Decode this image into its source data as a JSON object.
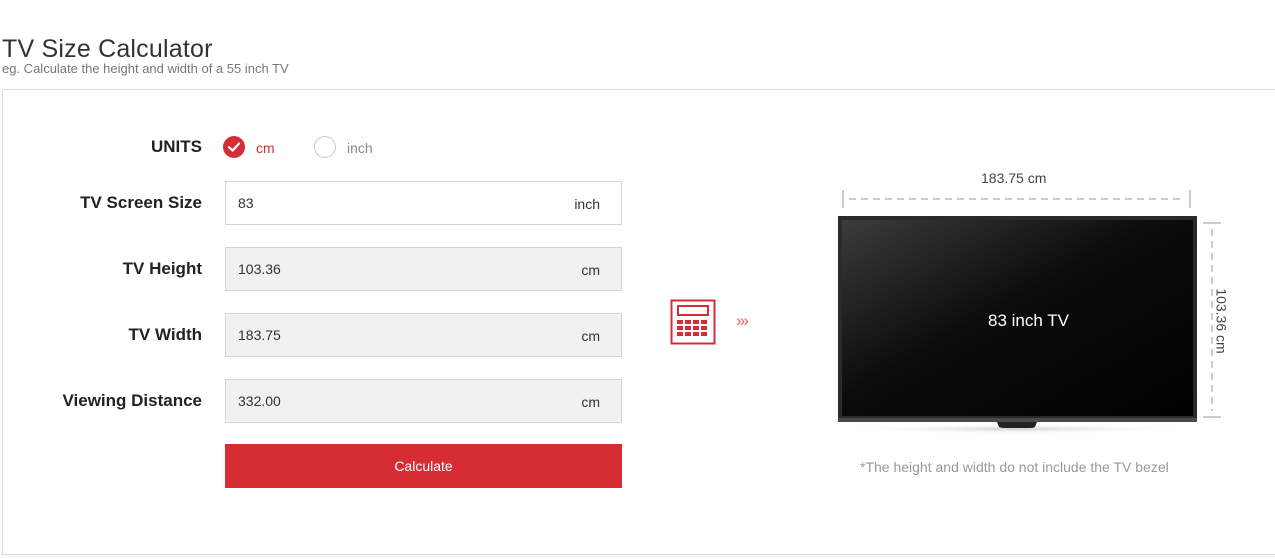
{
  "header": {
    "title": "TV Size Calculator",
    "subtitle": "eg. Calculate the height and width of a 55 inch TV"
  },
  "form": {
    "units_label": "UNITS",
    "unit_options": [
      {
        "label": "cm",
        "selected": true
      },
      {
        "label": "inch",
        "selected": false
      }
    ],
    "screen_size": {
      "label": "TV Screen Size",
      "value": "83",
      "unit": "inch"
    },
    "height": {
      "label": "TV Height",
      "value": "103.36",
      "unit": "cm"
    },
    "width": {
      "label": "TV Width",
      "value": "183.75",
      "unit": "cm"
    },
    "viewing_distance": {
      "label": "Viewing Distance",
      "value": "332.00",
      "unit": "cm"
    },
    "calculate_label": "Calculate"
  },
  "preview": {
    "arrows": "›››",
    "tv_label": "83 inch TV",
    "width_text": "183.75 cm",
    "height_text": "103.36 cm",
    "note": "*The height and width do not include the TV bezel"
  },
  "colors": {
    "accent": "#d62c34",
    "readonly_field": "#f1f1f1",
    "muted_text": "#999999"
  },
  "icons": [
    "check-icon",
    "calculator-icon",
    "triple-chevron-right-icon",
    "tv-icon"
  ]
}
